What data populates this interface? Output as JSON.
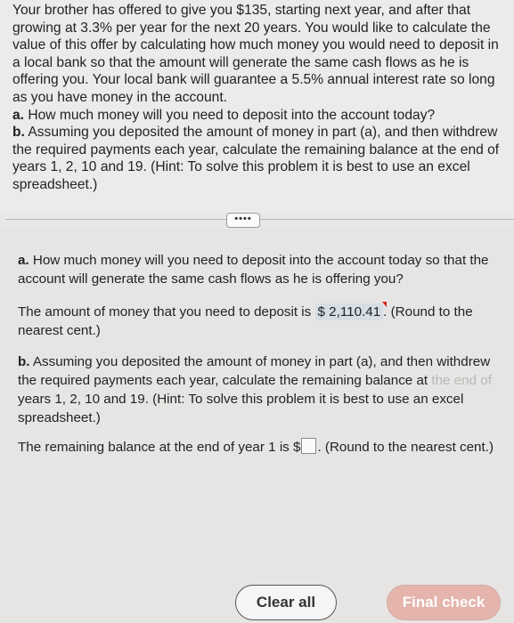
{
  "problem": {
    "intro": "Your brother has offered to give you $135, starting next year, and after that growing at 3.3% per year for the next 20 years. You would like to calculate the value of this offer by calculating how much money you would need to deposit in a local bank so that the amount will generate the same cash flows as he is offering you. Your local bank will guarantee a 5.5% annual interest rate so long as you have money in the account.",
    "part_a_label": "a.",
    "part_a_text": " How much money will you need to deposit into the account today?",
    "part_b_label": "b.",
    "part_b_text": " Assuming you deposited the amount of money in part (a), and then withdrew the required payments each year, calculate the remaining balance at the end of years 1, 2, 10 and 19. (Hint: To solve this problem it is best to use an excel spreadsheet.)"
  },
  "more_button": "••••",
  "answer": {
    "qa_label": "a.",
    "qa_text": " How much money will you need to deposit into the account today so that the account will generate the same cash flows as he is offering you?",
    "amount_prefix": "The amount of money that you need to deposit is ",
    "amount_value": "$ 2,110.41",
    "amount_suffix": ". (Round to the nearest cent.)",
    "qb_label": "b.",
    "qb_text_1": " Assuming you deposited the amount of money in part (a), and then withdrew the required payments each year, calculate the remaining balance at ",
    "qb_faded": "the end of",
    "qb_text_2": " years 1, 2, 10 and 19. (Hint: To solve this problem it is best to use an excel spreadsheet.)",
    "remaining_prefix": "The remaining balance at the end of year 1 is $",
    "remaining_suffix": ". (Round to the nearest cent.)"
  },
  "buttons": {
    "clear_all": "Clear all",
    "final_check": "Final check"
  }
}
